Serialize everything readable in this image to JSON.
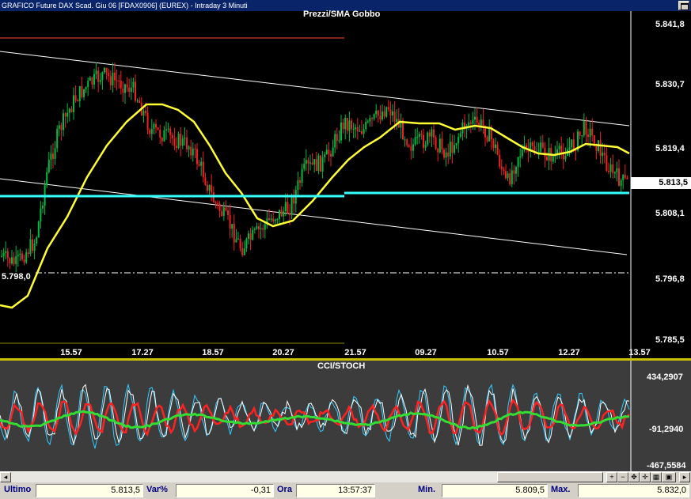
{
  "window": {
    "title": "GRAFICO Future DAX Scad. Giu 06 [FDAX0906] (EUREX) - Intraday 3 Minuti"
  },
  "price_panel": {
    "title": "Prezzi/SMA Gobbo",
    "y_ticks": [
      "5.841,8",
      "5.830,7",
      "5.819,4",
      "5.808,1",
      "5.796,8",
      "5.785,5"
    ],
    "last_price_label": "5.813,5",
    "support_label": "5.798,0",
    "time_labels": [
      "15.57",
      "17.27",
      "18.57",
      "20.27",
      "21.57",
      "09.27",
      "10.57",
      "12.27",
      "13.57"
    ],
    "colors": {
      "sma": "#ffff33",
      "support": "#33ffff",
      "up_candle": "#00bb44",
      "down_candle": "#ee2222",
      "channel": "#ffffff",
      "resistance": "#ff4422"
    }
  },
  "indicator_panel": {
    "title": "CCI/STOCH",
    "y_ticks": [
      "434,2907",
      "-91,2940",
      "-467,5584"
    ],
    "colors": {
      "cci": "#ffffff",
      "stoch_fast": "#33ccff",
      "stoch_slow": "#33dd33",
      "signal": "#ff2222"
    }
  },
  "scrollbar": {
    "icons": [
      "scroll-left-icon",
      "zoom-in-icon",
      "zoom-out-icon",
      "move-icon",
      "magnify-icon",
      "grid-icon",
      "chart-icon",
      "scroll-right-icon"
    ],
    "glyphs": [
      "+",
      "−",
      "✥",
      "✛",
      "▦",
      "▣"
    ]
  },
  "status": {
    "ultimo_label": "Ultimo",
    "ultimo_value": "5.813,5",
    "var_label": "Var%",
    "var_value": "-0,31",
    "ora_label": "Ora",
    "ora_value": "13:57:37",
    "min_label": "Min.",
    "min_value": "5.809,5",
    "max_label": "Max.",
    "max_value": "5.832,0"
  }
}
